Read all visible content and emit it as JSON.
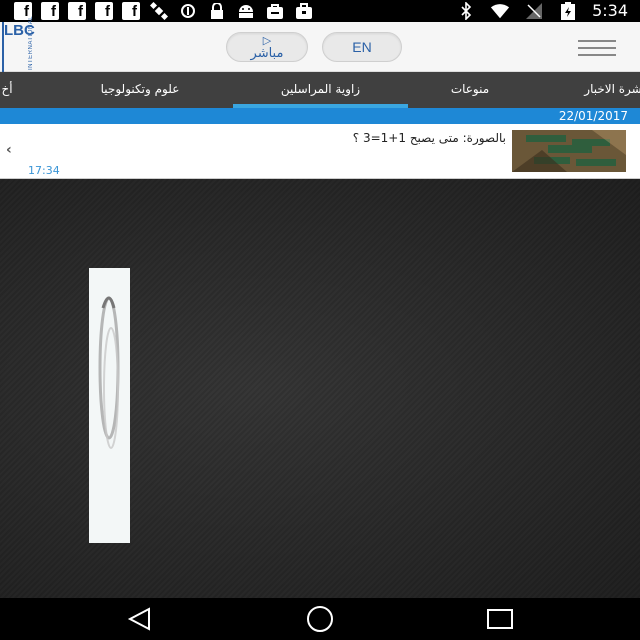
{
  "status_bar": {
    "time": "5:34",
    "left_icons": [
      "facebook-icon",
      "facebook-icon",
      "facebook-icon",
      "facebook-icon",
      "facebook-icon",
      "satellite-icon",
      "circle-icon",
      "lock-icon",
      "android-icon",
      "bag-icon",
      "briefcase-icon"
    ],
    "right_icons": [
      "bluetooth-icon",
      "wifi-icon",
      "signal-icon",
      "battery-icon"
    ]
  },
  "header": {
    "logo_text": "LBC",
    "logo_subtext": "INTERNATIONAL",
    "live_label": "مباشر",
    "lang_label": "EN"
  },
  "tabs": [
    {
      "label": "نشرة الاخبار",
      "active": false
    },
    {
      "label": "منوعات",
      "active": false
    },
    {
      "label": "زاوية المراسلين",
      "active": true
    },
    {
      "label": "علوم وتكنولوجيا",
      "active": false
    },
    {
      "label": "أخ",
      "active": false
    }
  ],
  "date": "22/01/2017",
  "news": {
    "title": "بالصورة: متى يصبح 1+1=3 ؟",
    "time": "17:34"
  },
  "colors": {
    "accent_blue": "#1e88d6",
    "tab_bg": "#404040",
    "logo_blue": "#2b61a7"
  }
}
